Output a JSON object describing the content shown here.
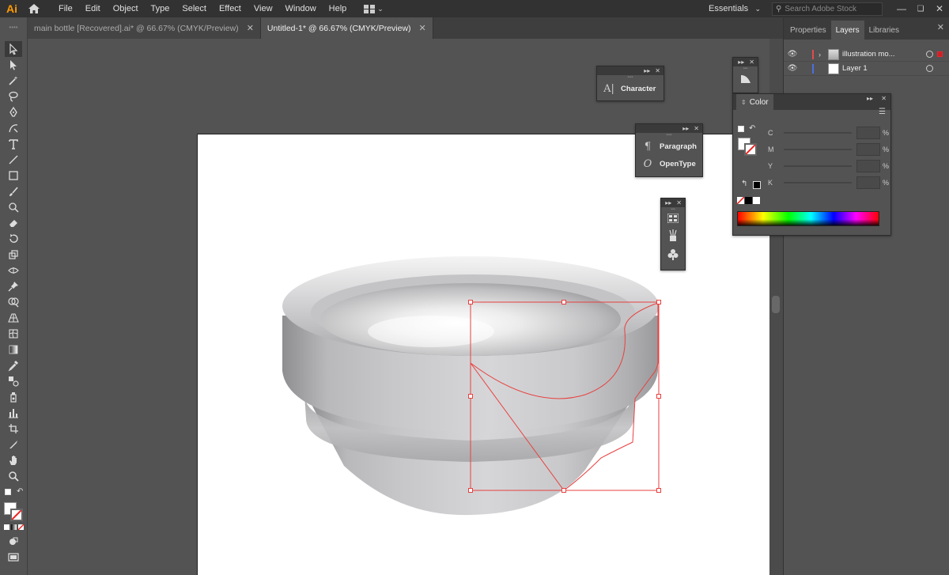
{
  "app": {
    "logo": "Ai"
  },
  "menu": [
    "File",
    "Edit",
    "Object",
    "Type",
    "Select",
    "Effect",
    "View",
    "Window",
    "Help"
  ],
  "workspace": "Essentials",
  "search": {
    "placeholder": "Search Adobe Stock"
  },
  "doc_tabs": [
    {
      "label": "main bottle [Recovered].ai* @ 66.67% (CMYK/Preview)",
      "active": false
    },
    {
      "label": "Untitled-1* @ 66.67% (CMYK/Preview)",
      "active": true
    }
  ],
  "dock": {
    "tabs": [
      "Properties",
      "Layers",
      "Libraries"
    ],
    "active_tab": "Layers",
    "layers": [
      {
        "name": "illustration mo...",
        "color": "#e34b4b",
        "expandable": true
      },
      {
        "name": "Layer 1",
        "color": "#4b6fe3",
        "expandable": false
      }
    ]
  },
  "panels": {
    "character": {
      "label": "Character",
      "icon": "character-icon"
    },
    "paragraph": {
      "label": "Paragraph",
      "icon": "paragraph-icon"
    },
    "opentype": {
      "label": "OpenType",
      "icon": "opentype-icon"
    },
    "color": {
      "title": "Color",
      "channels": [
        "C",
        "M",
        "Y",
        "K"
      ],
      "unit": "%"
    }
  },
  "colors": {
    "accent_selection": "#e8403f",
    "ui_dark": "#323232",
    "ui_mid": "#535353"
  }
}
